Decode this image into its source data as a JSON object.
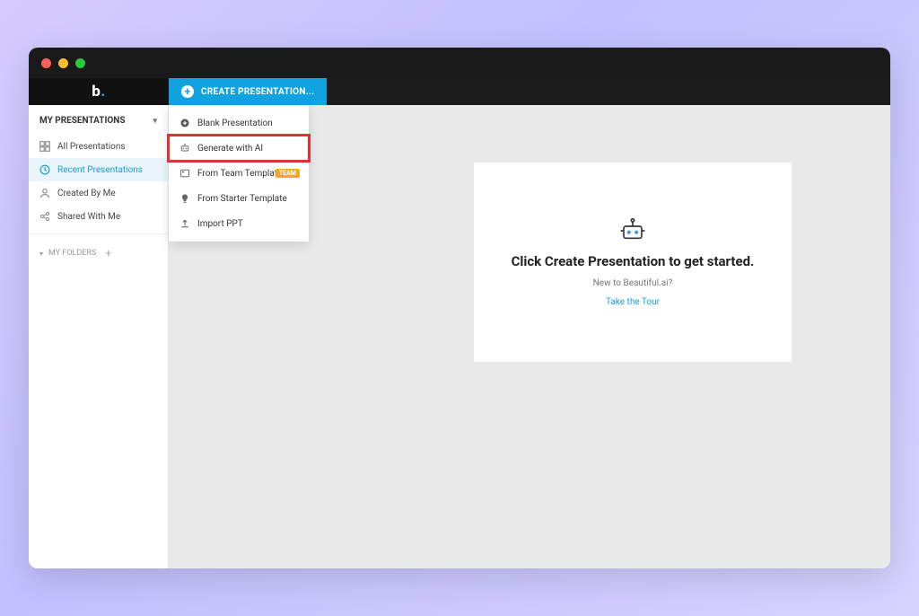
{
  "create_button": "CREATE PRESENTATION...",
  "sidebar": {
    "header": "MY PRESENTATIONS",
    "items": [
      {
        "label": "All Presentations"
      },
      {
        "label": "Recent Presentations"
      },
      {
        "label": "Created By Me"
      },
      {
        "label": "Shared With Me"
      }
    ],
    "folders_label": "MY FOLDERS"
  },
  "dropdown": {
    "items": [
      {
        "label": "Blank Presentation"
      },
      {
        "label": "Generate with AI"
      },
      {
        "label": "From Team Template",
        "badge": "TEAM"
      },
      {
        "label": "From Starter Template"
      },
      {
        "label": "Import PPT"
      }
    ]
  },
  "card": {
    "title": "Click Create Presentation to get started.",
    "subtitle": "New to Beautiful.ai?",
    "tour": "Take the Tour"
  }
}
